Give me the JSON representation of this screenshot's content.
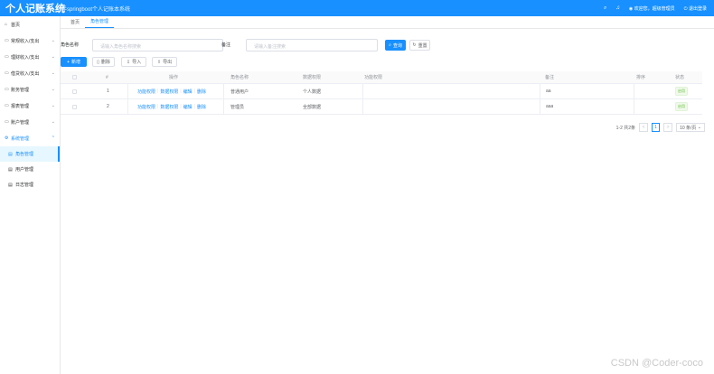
{
  "header": {
    "logo": "个人记账系统",
    "subtitle": "手springboot个人记账本系统",
    "search_icon": "search-icon",
    "bell_icon": "bell-icon",
    "user": "欢迎您，超级管理员",
    "logout": "退出登录",
    "brand_color": "#1890ff"
  },
  "sidebar": {
    "items": [
      {
        "icon": "⌂",
        "label": "首页"
      },
      {
        "icon": "▭",
        "label": "常规收入/支出",
        "arrow": "⌄"
      },
      {
        "icon": "▭",
        "label": "理财收入/支出",
        "arrow": "⌄"
      },
      {
        "icon": "▭",
        "label": "借贷收入/支出",
        "arrow": "⌄"
      },
      {
        "icon": "▭",
        "label": "账务管理",
        "arrow": "⌄"
      },
      {
        "icon": "▭",
        "label": "报表管理",
        "arrow": "⌄"
      },
      {
        "icon": "▭",
        "label": "账户管理",
        "arrow": "⌄"
      },
      {
        "icon": "⚙",
        "label": "系统管理",
        "arrow": "⌃"
      }
    ],
    "subitems": [
      {
        "icon": "▤",
        "label": "角色管理"
      },
      {
        "icon": "▤",
        "label": "用户管理"
      },
      {
        "icon": "▤",
        "label": "日志管理"
      }
    ]
  },
  "tabs": [
    {
      "label": "首页"
    },
    {
      "label": "角色管理"
    }
  ],
  "search": {
    "label1": "角色名称",
    "placeholder1": "请输入角色名称搜索",
    "label2": "备注",
    "placeholder2": "请输入备注搜索",
    "search_btn": "查询",
    "reset_btn": "重置"
  },
  "toolbar": {
    "add": "新增",
    "delete": "删除",
    "import": "导入",
    "export": "导出"
  },
  "table": {
    "headers": {
      "index": "#",
      "ops": "操作",
      "role": "角色名称",
      "data_perm": "数据权限",
      "menu_perm": "功能权限",
      "remark": "备注",
      "sort": "排序",
      "status": "状态"
    },
    "rows": [
      {
        "index": "1",
        "ops": [
          "功能权限",
          "数据权限",
          "编辑",
          "删除"
        ],
        "role": "普通用户",
        "data_perm": "个人数据",
        "menu_perm": "",
        "remark": "aa",
        "status": "启用"
      },
      {
        "index": "2",
        "ops": [
          "功能权限",
          "数据权限",
          "编辑",
          "删除"
        ],
        "role": "管理员",
        "data_perm": "全部数据",
        "menu_perm": "",
        "remark": "aaa",
        "status": "启用"
      }
    ]
  },
  "pager": {
    "total": "1-2 共2条",
    "prev": "<",
    "page": "1",
    "next": ">",
    "size": "10 条/页"
  },
  "watermark": "CSDN @Coder-coco"
}
